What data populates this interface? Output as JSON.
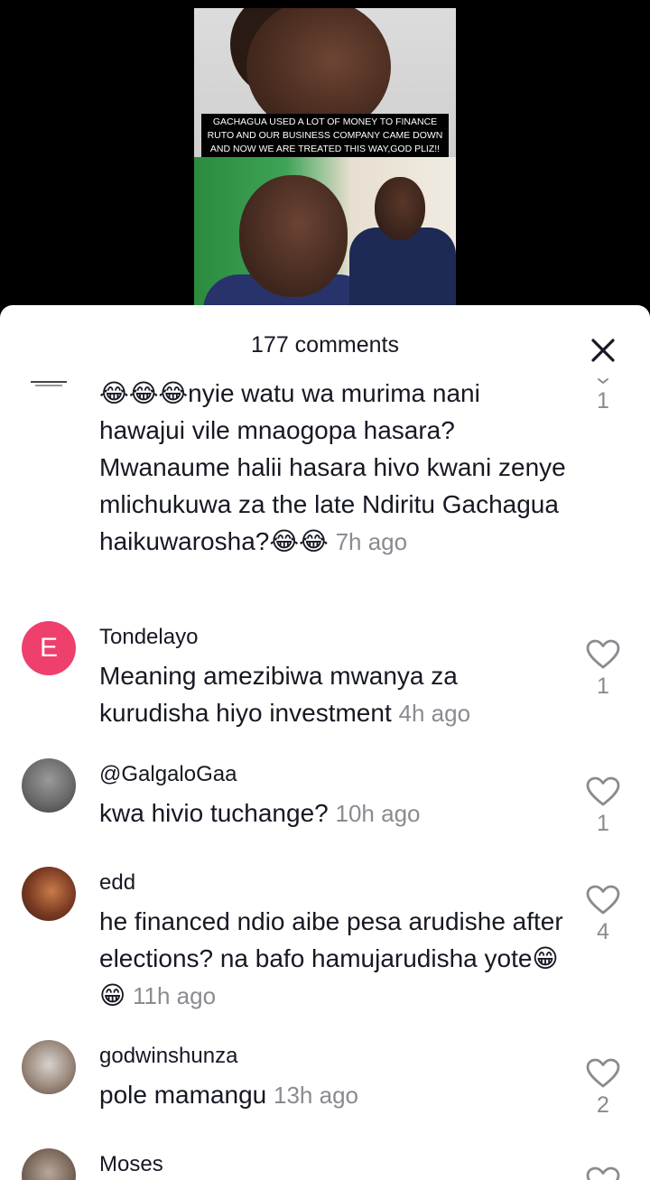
{
  "video": {
    "caption": "GACHAGUA USED A LOT OF MONEY TO FINANCE RUTO AND OUR BUSINESS COMPANY CAME DOWN AND NOW WE ARE TREATED THIS WAY,GOD PLIZ!!"
  },
  "sheet": {
    "comments_count": "177 comments"
  },
  "comments": [
    {
      "username": "",
      "text": "😂😂😂nyie watu wa murima nani hawajui vile mnaogopa hasara? Mwanaume halii hasara hivo kwani zenye mlichukuwa za the late Ndiritu Gachagua haikuwarosha?😂😂",
      "time": "7h ago",
      "likes": "1"
    },
    {
      "avatar_letter": "E",
      "username": "Tondelayo",
      "text": "Meaning amezibiwa mwanya za kurudisha hiyo investment",
      "time": "4h ago",
      "likes": "1"
    },
    {
      "username": "@GalgaloGaa",
      "text": "kwa hivio tuchange?",
      "time": "10h ago",
      "likes": "1"
    },
    {
      "username": "edd",
      "text": "he financed ndio aibe pesa arudishe after elections? na bafo hamujarudisha yote😁😁",
      "time": "11h ago",
      "likes": "4"
    },
    {
      "username": "godwinshunza",
      "text": "pole mamangu",
      "time": "13h ago",
      "likes": "2"
    },
    {
      "username": "Moses",
      "text": "",
      "time": "",
      "likes": ""
    }
  ],
  "colors": {
    "accent_avatar": "#ee3f6d",
    "muted_text": "#8a8b91",
    "primary_text": "#161823"
  },
  "icons": {
    "close": "close-icon",
    "like": "heart-outline-icon"
  }
}
